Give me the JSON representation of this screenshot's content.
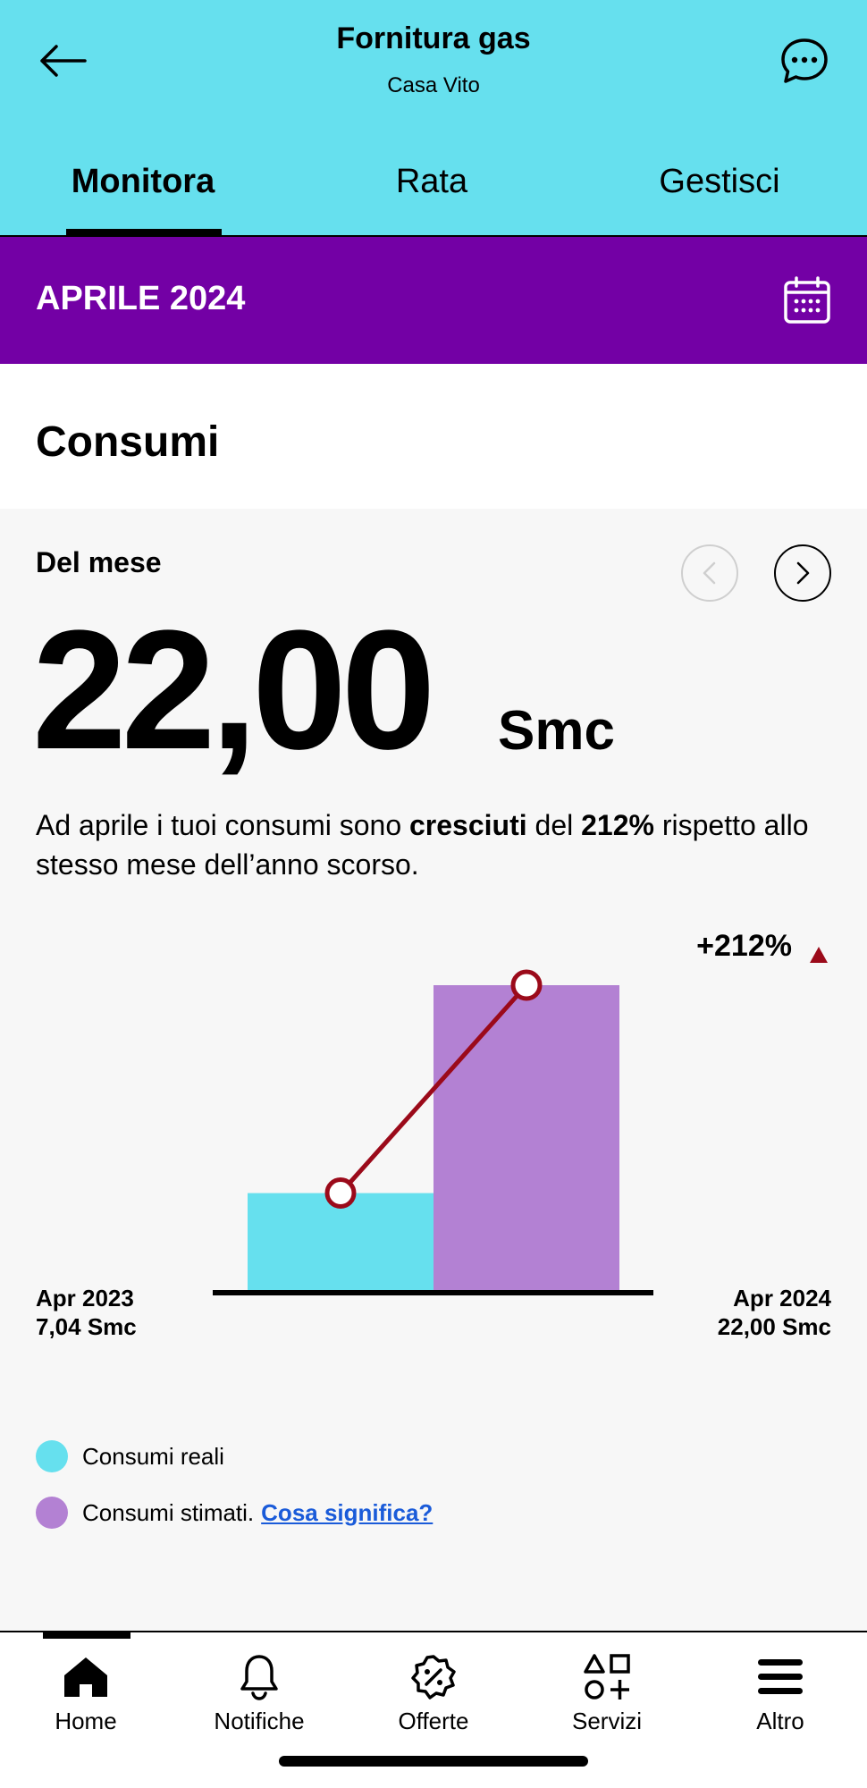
{
  "header": {
    "title": "Fornitura gas",
    "subtitle": "Casa Vito",
    "tabs": [
      "Monitora",
      "Rata",
      "Gestisci"
    ],
    "active_tab": "Monitora"
  },
  "month_bar": {
    "label": "APRILE 2024"
  },
  "consumi": {
    "title": "Consumi",
    "period_label": "Del mese",
    "value": "22,00",
    "unit": "Smc",
    "desc_prefix": "Ad aprile i tuoi consumi sono ",
    "desc_bold1": "cresciuti",
    "desc_mid": " del ",
    "desc_bold2": "212%",
    "desc_suffix": " rispetto allo stesso mese dell’anno scorso."
  },
  "chart_data": {
    "type": "bar",
    "categories": [
      "Apr 2023",
      "Apr 2024"
    ],
    "values": [
      7.04,
      22.0
    ],
    "value_labels": [
      "7,04 Smc",
      "22,00 Smc"
    ],
    "bar_colors": [
      "#66E0EE",
      "#B381D3"
    ],
    "line_color": "#9B0A1A",
    "change_label": "+212%",
    "ylim": [
      0,
      22.0
    ]
  },
  "legend": {
    "items": [
      {
        "label": "Consumi reali",
        "color": "#66E0EE"
      },
      {
        "label": "Consumi stimati.",
        "color": "#B381D3",
        "link": "Cosa significa?"
      }
    ]
  },
  "bottom_nav": {
    "items": [
      {
        "label": "Home",
        "icon": "home-icon"
      },
      {
        "label": "Notifiche",
        "icon": "bell-icon"
      },
      {
        "label": "Offerte",
        "icon": "discount-badge-icon"
      },
      {
        "label": "Servizi",
        "icon": "shapes-icon"
      },
      {
        "label": "Altro",
        "icon": "menu-icon"
      }
    ]
  },
  "colors": {
    "header_bg": "#66E0EE",
    "month_bar_bg": "#7300A5",
    "card_bg": "#F7F7F7",
    "increase_arrow": "#9B0A1A"
  }
}
